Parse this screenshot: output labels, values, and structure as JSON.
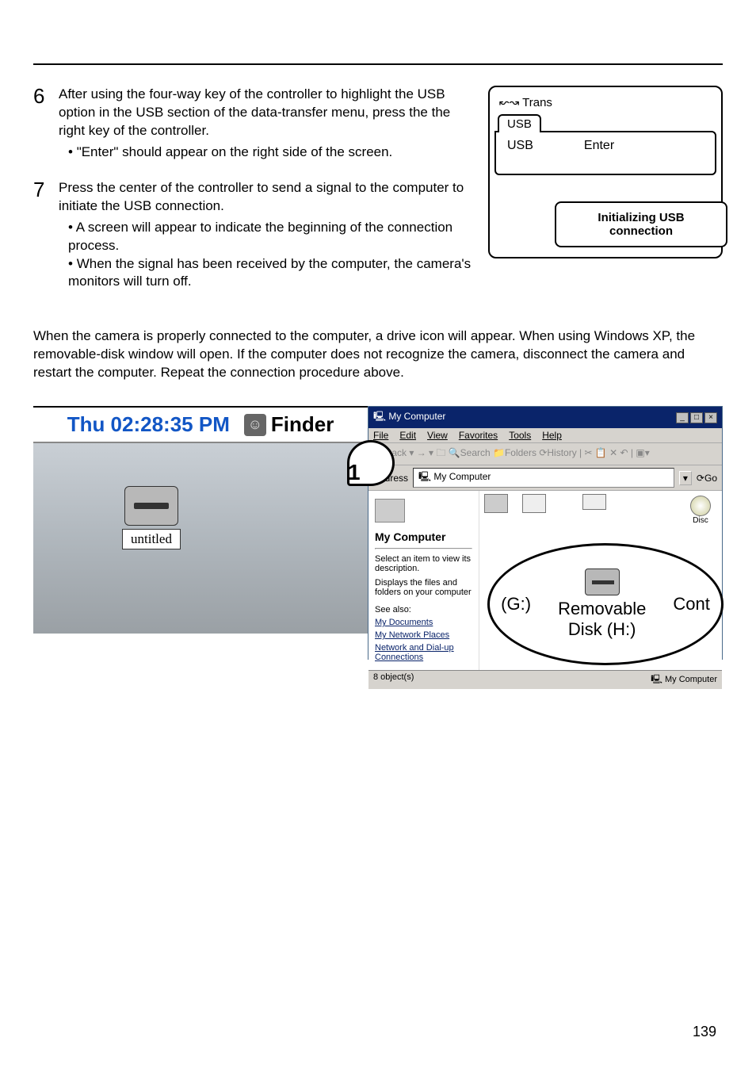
{
  "steps": {
    "s6": {
      "num": "6",
      "text": "After using the four-way key of the controller to highlight the USB option in the USB section of the data-transfer menu, press the the right key of the controller.",
      "bullet1": "\"Enter\" should appear on the right side of the screen."
    },
    "s7": {
      "num": "7",
      "text": "Press the center of the controller to send a signal to the computer to initiate the USB connection.",
      "bullet1": "A screen will appear to indicate the beginning of the connection process.",
      "bullet2": "When the signal has been received by the computer, the camera's monitors will turn off."
    }
  },
  "lcd": {
    "trans_icon": "↜↝",
    "trans": "Trans",
    "tab": "USB",
    "row_label": "USB",
    "row_value": "Enter",
    "overlay_l1": "Initializing USB",
    "overlay_l2": "connection"
  },
  "main_para": "When the camera is properly connected to the computer, a drive icon will appear. When using Windows XP, the removable-disk window will open. If the computer does not recognize the camera, disconnect the camera and restart the computer. Repeat the connection procedure above.",
  "mac": {
    "clock": "Thu 02:28:35 PM",
    "finder": "Finder",
    "drive_label": "untitled",
    "zoom_num": "1"
  },
  "win": {
    "title": "My Computer",
    "menu": {
      "file": "File",
      "edit": "Edit",
      "view": "View",
      "fav": "Favorites",
      "tools": "Tools",
      "help": "Help"
    },
    "toolbar": "← Back  ▾  →  ▾  🗀   🔍Search  📁Folders  ⟳History   |  ✂ 📋 ✕ ↶ | ▣▾",
    "address_label": "Address",
    "address_value": "My Computer",
    "go": "Go",
    "left_pane": {
      "heading": "My Computer",
      "desc1": "Select an item to view its description.",
      "desc2": "Displays the files and folders on your computer",
      "see_also": "See also:",
      "link1": "My Documents",
      "link2": "My Network Places",
      "link3": "Network and Dial-up Connections"
    },
    "zoom": {
      "g_label": "(G:)",
      "h_label1": "Removable",
      "h_label2": "Disk (H:)",
      "cont": "Cont",
      "disc": "Disc"
    },
    "status_left": "8 object(s)",
    "status_right": "My Computer"
  },
  "page_number": "139"
}
